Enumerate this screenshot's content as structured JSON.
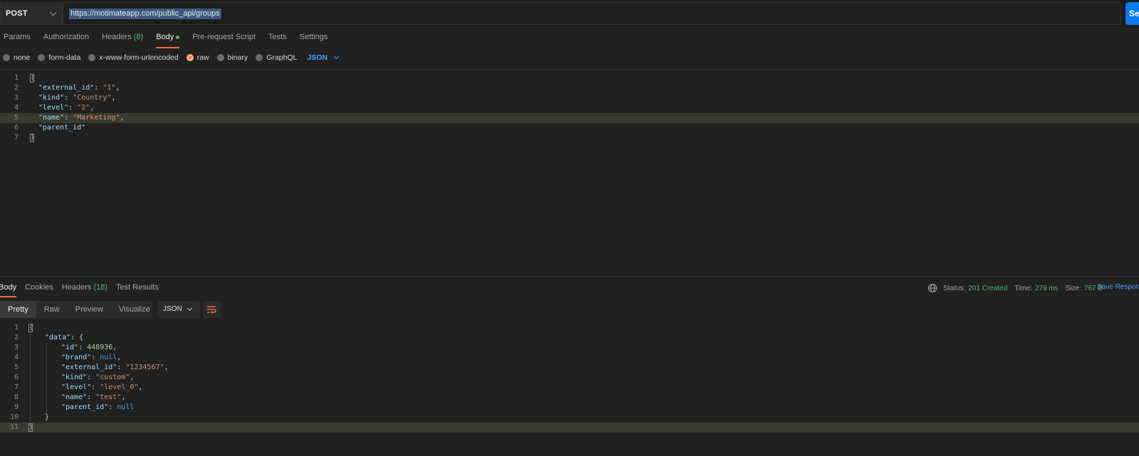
{
  "request": {
    "method": "POST",
    "url": "https://motimateapp.com/public_api/groups",
    "send_label": "Send"
  },
  "request_tabs": [
    {
      "label": "Params"
    },
    {
      "label": "Authorization"
    },
    {
      "label": "Headers",
      "count": "(8)"
    },
    {
      "label": "Body"
    },
    {
      "label": "Pre-request Script"
    },
    {
      "label": "Tests"
    },
    {
      "label": "Settings"
    }
  ],
  "body_types": [
    "none",
    "form-data",
    "x-www-form-urlencoded",
    "raw",
    "binary",
    "GraphQL"
  ],
  "body_format": "JSON",
  "request_body": {
    "line_numbers": [
      "1",
      "2",
      "3",
      "4",
      "5",
      "6",
      "7"
    ],
    "lines": [
      {
        "open": "{"
      },
      {
        "key": "\"external_id\"",
        "sep": ": ",
        "str": "\"1\"",
        "end": ","
      },
      {
        "key": "\"kind\"",
        "sep": ": ",
        "str": "\"Country\"",
        "end": ","
      },
      {
        "key": "\"level\"",
        "sep": ": ",
        "str": "\"2\"",
        "end": ","
      },
      {
        "key": "\"name\"",
        "sep": ": ",
        "str": "\"Marketing\"",
        "end": ","
      },
      {
        "key": "\"parent_id\""
      },
      {
        "close": "}"
      }
    ]
  },
  "response_tabs": [
    {
      "label": "Body"
    },
    {
      "label": "Cookies"
    },
    {
      "label": "Headers",
      "count": "(18)"
    },
    {
      "label": "Test Results"
    }
  ],
  "response_status": {
    "status_label": "Status:",
    "status_value": "201 Created",
    "time_label": "Time:",
    "time_value": "279 ms",
    "size_label": "Size:",
    "size_value": "767 B",
    "save_label": "Save Response"
  },
  "view_modes": [
    "Pretty",
    "Raw",
    "Preview",
    "Visualize"
  ],
  "response_format": "JSON",
  "response_body": {
    "line_numbers": [
      "1",
      "2",
      "3",
      "4",
      "5",
      "6",
      "7",
      "8",
      "9",
      "10",
      "11"
    ],
    "lines": [
      {
        "open": "{"
      },
      {
        "indent": 1,
        "key": "\"data\"",
        "sep": ": ",
        "punct": "{"
      },
      {
        "indent": 2,
        "key": "\"id\"",
        "sep": ": ",
        "num": "448936",
        "end": ","
      },
      {
        "indent": 2,
        "key": "\"brand\"",
        "sep": ": ",
        "lit": "null",
        "end": ","
      },
      {
        "indent": 2,
        "key": "\"external_id\"",
        "sep": ": ",
        "str": "\"1234567\"",
        "end": ","
      },
      {
        "indent": 2,
        "key": "\"kind\"",
        "sep": ": ",
        "str": "\"custom\"",
        "end": ","
      },
      {
        "indent": 2,
        "key": "\"level\"",
        "sep": ": ",
        "str": "\"level_0\"",
        "end": ","
      },
      {
        "indent": 2,
        "key": "\"name\"",
        "sep": ": ",
        "str": "\"test\"",
        "end": ","
      },
      {
        "indent": 2,
        "key": "\"parent_id\"",
        "sep": ": ",
        "lit": "null"
      },
      {
        "indent": 1,
        "punct": "}"
      },
      {
        "close": "}"
      }
    ]
  },
  "colors": {
    "accent": "#ff6c37",
    "send": "#097bed",
    "success": "#4cb877",
    "link": "#4aa3ff"
  }
}
